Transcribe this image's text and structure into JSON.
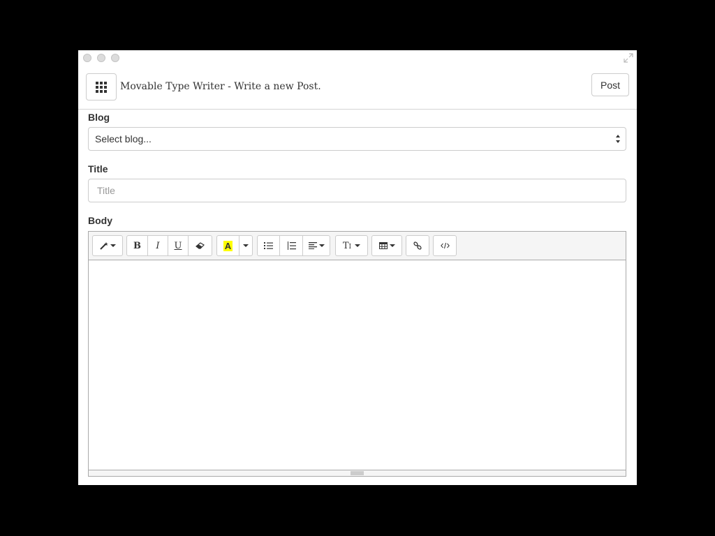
{
  "window": {
    "controls": [
      "close-icon",
      "minimize-icon",
      "zoom-icon"
    ],
    "fullscreen_icon": "fullscreen-icon"
  },
  "header": {
    "menu_icon": "grid-icon",
    "title": "Movable Type Writer - Write a new Post.",
    "post_label": "Post"
  },
  "form": {
    "blog": {
      "label": "Blog",
      "selected": "Select blog..."
    },
    "title": {
      "label": "Title",
      "placeholder": "Title",
      "value": ""
    },
    "body": {
      "label": "Body",
      "content": ""
    }
  },
  "toolbar": {
    "style_icon": "magic-wand-icon",
    "bold": "B",
    "italic": "I",
    "underline": "U",
    "eraser_icon": "eraser-icon",
    "color_letter": "A",
    "color_highlight": "#ffff00",
    "unordered_list_icon": "unordered-list-icon",
    "ordered_list_icon": "ordered-list-icon",
    "align_icon": "align-left-icon",
    "font_size_label": "T",
    "table_icon": "table-icon",
    "link_icon": "link-icon",
    "code_view_icon": "code-view-icon"
  },
  "colors": {
    "background": "#000000",
    "border": "#cccccc",
    "toolbar_bg": "#f5f5f5",
    "text": "#333333"
  }
}
